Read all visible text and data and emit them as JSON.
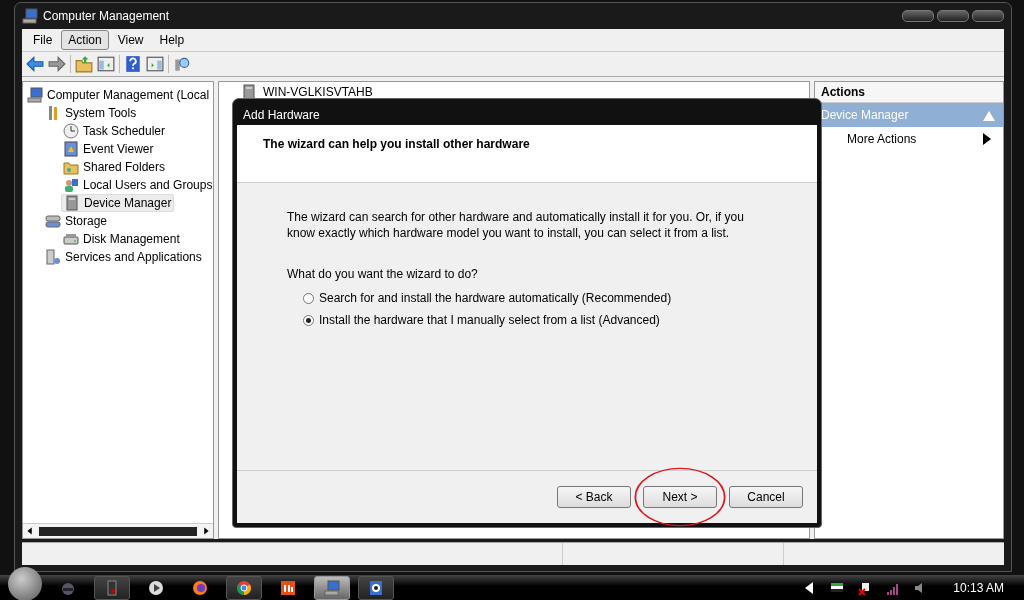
{
  "window": {
    "title": "Computer Management"
  },
  "menu": [
    {
      "label": "File",
      "selected": false
    },
    {
      "label": "Action",
      "selected": true
    },
    {
      "label": "View",
      "selected": false
    },
    {
      "label": "Help",
      "selected": false
    }
  ],
  "tree": [
    {
      "label": "Computer Management (Local",
      "selected": false,
      "children": [
        {
          "label": "System Tools",
          "selected": false,
          "children": [
            {
              "label": "Task Scheduler",
              "selected": false
            },
            {
              "label": "Event Viewer",
              "selected": false
            },
            {
              "label": "Shared Folders",
              "selected": false
            },
            {
              "label": "Local Users and Groups",
              "selected": false
            },
            {
              "label": "Device Manager",
              "selected": true
            }
          ]
        },
        {
          "label": "Storage",
          "selected": false,
          "children": [
            {
              "label": "Disk Management",
              "selected": false
            }
          ]
        },
        {
          "label": "Services and Applications",
          "selected": false
        }
      ]
    }
  ],
  "center": {
    "root": "WIN-VGLKISVTAHB"
  },
  "actions": {
    "title": "Actions",
    "section": "Device Manager",
    "items": [
      {
        "label": "More Actions"
      }
    ]
  },
  "dialog": {
    "title": "Add Hardware",
    "heading": "The wizard can help you install other hardware",
    "intro": "The wizard can search for other hardware and automatically install it for you. Or, if you know exactly which hardware model you want to install, you can select it from a list.",
    "question": "What do you want the wizard to do?",
    "options": [
      {
        "label": "Search for and install the hardware automatically (Recommended)",
        "selected": false
      },
      {
        "label": "Install the hardware that I manually select from a list (Advanced)",
        "selected": true
      }
    ],
    "buttons": [
      {
        "label": "< Back"
      },
      {
        "label": "Next >",
        "circled": true
      },
      {
        "label": "Cancel"
      }
    ]
  },
  "taskbar": {
    "clock": "10:13 AM"
  }
}
